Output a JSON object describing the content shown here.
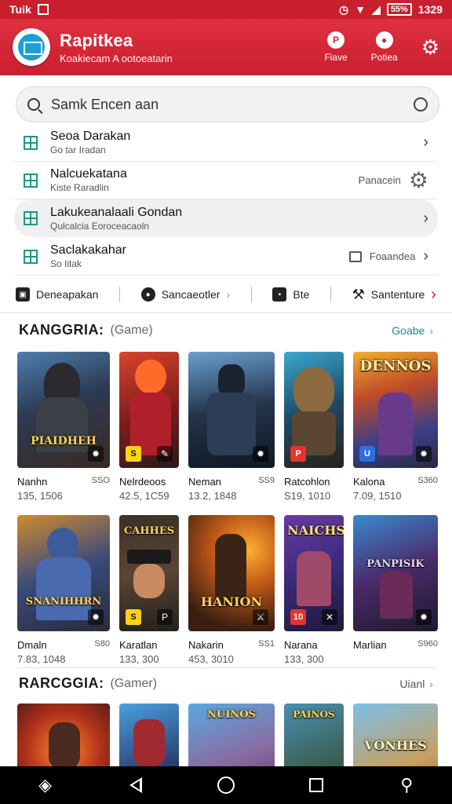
{
  "status_bar": {
    "left_text": "Tuik",
    "battery": "55%",
    "time": "1329"
  },
  "header": {
    "title": "Rapitkea",
    "subtitle": "Koakiecam A ootoeatarin",
    "actions": [
      {
        "label": "Fiave",
        "icon": "p-circle-icon"
      },
      {
        "label": "Potiea",
        "icon": "record-icon"
      }
    ],
    "settings_icon": "gear-icon"
  },
  "search": {
    "value": "Samk Encen aan",
    "placeholder": "Samk Encen aan"
  },
  "menu": [
    {
      "title": "Seoa Darakan",
      "subtitle": "Go tar Iradan",
      "right_text": "",
      "icon": "grid-icon"
    },
    {
      "title": "Nalcuekatana",
      "subtitle": "Kiste Raradlin",
      "right_text": "Panacein",
      "icon": "grid-icon"
    },
    {
      "title": "Lakukeanalaali Gondan",
      "subtitle": "Qulcalcia Eoroceacaoln",
      "right_text": "",
      "icon": "grid-icon"
    },
    {
      "title": "Saclakakahar",
      "subtitle": "So Iitak",
      "right_text": "Foaandea",
      "icon": "grid-icon"
    }
  ],
  "tabs": [
    {
      "label": "Deneapakan"
    },
    {
      "label": "Sancaeotler"
    },
    {
      "label": "Bte"
    },
    {
      "label": "Santenture"
    }
  ],
  "sections": [
    {
      "title": "KANGGRIA:",
      "subtitle": "(Game)",
      "more": "Goabe"
    },
    {
      "title": "RARCGGIA:",
      "subtitle": "(Gamer)",
      "more": "Uianl"
    }
  ],
  "games_row1": [
    {
      "name": "Nanhn",
      "price": "SSO",
      "stats": "135, 1506",
      "cover_text": "PIAIDHEH",
      "badge": ""
    },
    {
      "name": "Nelrdeoos",
      "price": "",
      "stats": "42.5, 1C59",
      "cover_text": "",
      "badge": "S"
    },
    {
      "name": "Neman",
      "price": "SS9",
      "stats": "13.2, 1848",
      "cover_text": "",
      "badge": ""
    },
    {
      "name": "Ratcohlon",
      "price": "",
      "stats": "S19, 1010",
      "cover_text": "",
      "badge": "P"
    },
    {
      "name": "Kalona",
      "price": "S360",
      "stats": "7.09, 1510",
      "cover_text": "DENNOS",
      "badge": "U"
    }
  ],
  "games_row2": [
    {
      "name": "Dmaln",
      "price": "S80",
      "stats": "7.83, 1048",
      "cover_text": "SNANIHHRN",
      "badge": ""
    },
    {
      "name": "Karatlan",
      "price": "",
      "stats": "133, 300",
      "cover_text": "CAHHES",
      "badge": "S"
    },
    {
      "name": "Nakarin",
      "price": "SS1",
      "stats": "453, 3010",
      "cover_text": "HANION",
      "badge": ""
    },
    {
      "name": "Narana",
      "price": "",
      "stats": "133, 300",
      "cover_text": "NAICHS",
      "badge": "10"
    },
    {
      "name": "Marlian",
      "price": "S960",
      "stats": "",
      "cover_text": "PANPISIK",
      "badge": ""
    }
  ],
  "games_row3": [
    {
      "cover_text": ""
    },
    {
      "cover_text": ""
    },
    {
      "cover_text": "NUINOS"
    },
    {
      "cover_text": "PAINOS"
    },
    {
      "cover_text": "VONHES"
    }
  ],
  "colors": {
    "accent": "#c8202e",
    "teal": "#1b9a82",
    "link": "#1a8c8c"
  }
}
